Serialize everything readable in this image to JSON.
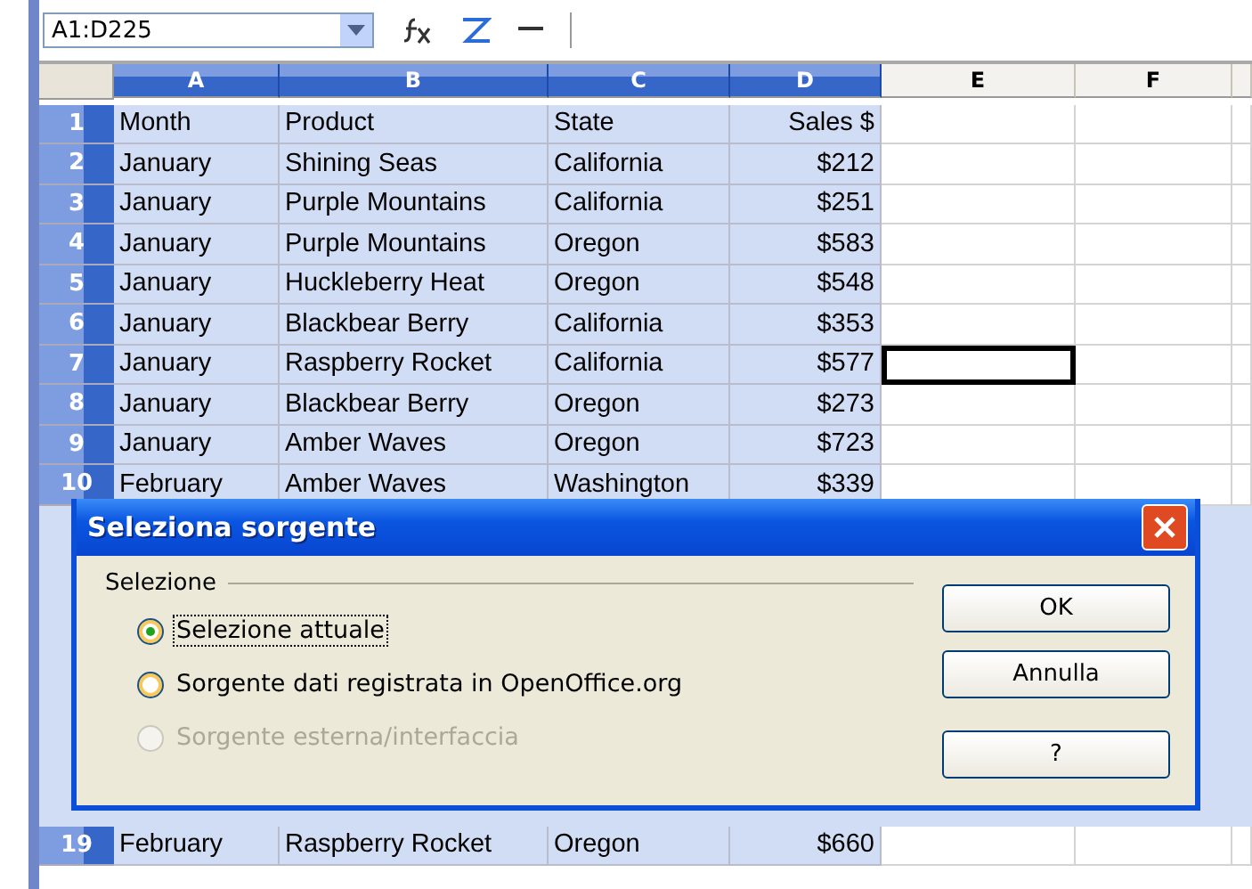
{
  "toolbar": {
    "name_box": "A1:D225"
  },
  "columns": [
    {
      "label": "A",
      "selected": true
    },
    {
      "label": "B",
      "selected": true
    },
    {
      "label": "C",
      "selected": true
    },
    {
      "label": "D",
      "selected": true
    },
    {
      "label": "E",
      "selected": false
    },
    {
      "label": "F",
      "selected": false
    }
  ],
  "rows": [
    {
      "number": "1",
      "cells": [
        "Month",
        "Product",
        "State",
        "Sales $"
      ],
      "selected": true,
      "e_cell_active": false
    },
    {
      "number": "2",
      "cells": [
        "January",
        "Shining Seas",
        "California",
        "$212"
      ],
      "selected": true,
      "e_cell_active": false
    },
    {
      "number": "3",
      "cells": [
        "January",
        "Purple Mountains",
        "California",
        "$251"
      ],
      "selected": true,
      "e_cell_active": false
    },
    {
      "number": "4",
      "cells": [
        "January",
        "Purple Mountains",
        "Oregon",
        "$583"
      ],
      "selected": true,
      "e_cell_active": false
    },
    {
      "number": "5",
      "cells": [
        "January",
        "Huckleberry Heat",
        "Oregon",
        "$548"
      ],
      "selected": true,
      "e_cell_active": false
    },
    {
      "number": "6",
      "cells": [
        "January",
        "Blackbear Berry",
        "California",
        "$353"
      ],
      "selected": true,
      "e_cell_active": false
    },
    {
      "number": "7",
      "cells": [
        "January",
        "Raspberry Rocket",
        "California",
        "$577"
      ],
      "selected": true,
      "e_cell_active": true
    },
    {
      "number": "8",
      "cells": [
        "January",
        "Blackbear Berry",
        "Oregon",
        "$273"
      ],
      "selected": true,
      "e_cell_active": false
    },
    {
      "number": "9",
      "cells": [
        "January",
        "Amber Waves",
        "Oregon",
        "$723"
      ],
      "selected": true,
      "e_cell_active": false
    },
    {
      "number": "10",
      "cells": [
        "February",
        "Amber Waves",
        "Washington",
        "$339"
      ],
      "selected": true,
      "e_cell_active": false
    },
    {
      "number": "19",
      "cells": [
        "February",
        "Raspberry Rocket",
        "Oregon",
        "$660"
      ],
      "selected": true,
      "e_cell_active": false
    }
  ],
  "dialog": {
    "title": "Seleziona sorgente",
    "group_label": "Selezione",
    "options": [
      {
        "label": "Selezione attuale",
        "selected": true,
        "disabled": false
      },
      {
        "label": "Sorgente dati registrata in OpenOffice.org",
        "selected": false,
        "disabled": false
      },
      {
        "label": "Sorgente esterna/interfaccia",
        "selected": false,
        "disabled": true
      }
    ],
    "buttons": [
      "OK",
      "Annulla",
      "?"
    ]
  }
}
